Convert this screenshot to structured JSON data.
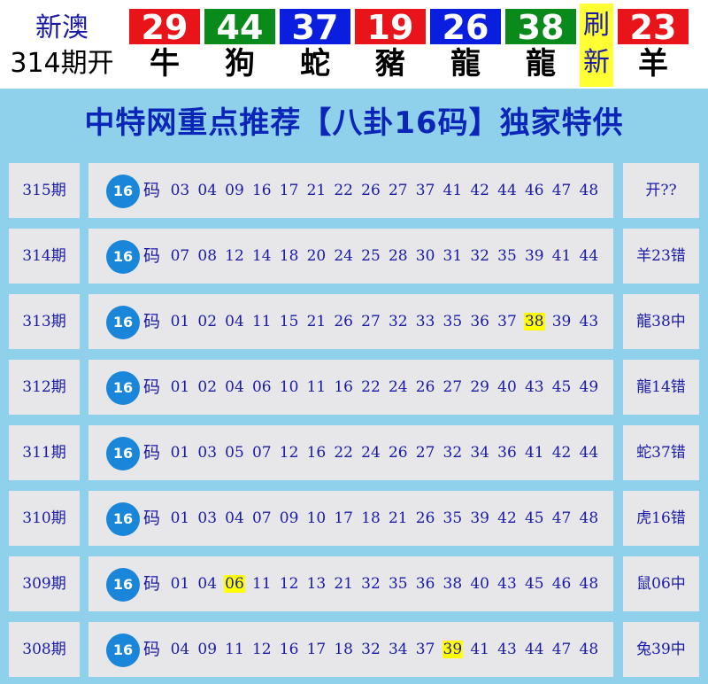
{
  "header": {
    "region": "新澳",
    "issue": "314期开",
    "balls": [
      {
        "number": "29",
        "zodiac": "牛",
        "color": "#e8141a"
      },
      {
        "number": "44",
        "zodiac": "狗",
        "color": "#0a8a1a"
      },
      {
        "number": "37",
        "zodiac": "蛇",
        "color": "#0a1ee0"
      },
      {
        "number": "19",
        "zodiac": "豬",
        "color": "#e8141a"
      },
      {
        "number": "26",
        "zodiac": "龍",
        "color": "#0a1ee0"
      },
      {
        "number": "38",
        "zodiac": "龍",
        "color": "#0a8a1a"
      }
    ],
    "refresh_label": "刷新",
    "special": {
      "number": "23",
      "zodiac": "羊",
      "color": "#e8141a"
    }
  },
  "banner": {
    "title": "中特网重点推荐【八卦16码】独家特供"
  },
  "rows": [
    {
      "issue": "315期",
      "badge": "16",
      "ma": "码",
      "numbers": [
        "03",
        "04",
        "09",
        "16",
        "17",
        "21",
        "22",
        "26",
        "27",
        "37",
        "41",
        "42",
        "44",
        "46",
        "47",
        "48"
      ],
      "highlight": null,
      "result": "开??"
    },
    {
      "issue": "314期",
      "badge": "16",
      "ma": "码",
      "numbers": [
        "07",
        "08",
        "12",
        "14",
        "18",
        "20",
        "24",
        "25",
        "28",
        "30",
        "31",
        "32",
        "35",
        "39",
        "41",
        "44"
      ],
      "highlight": null,
      "result": "羊23错"
    },
    {
      "issue": "313期",
      "badge": "16",
      "ma": "码",
      "numbers": [
        "01",
        "02",
        "04",
        "11",
        "15",
        "21",
        "26",
        "27",
        "32",
        "33",
        "35",
        "36",
        "37",
        "38",
        "39",
        "43"
      ],
      "highlight": "38",
      "result": "龍38中"
    },
    {
      "issue": "312期",
      "badge": "16",
      "ma": "码",
      "numbers": [
        "01",
        "02",
        "04",
        "06",
        "10",
        "11",
        "16",
        "22",
        "24",
        "26",
        "27",
        "29",
        "40",
        "43",
        "45",
        "49"
      ],
      "highlight": null,
      "result": "龍14错"
    },
    {
      "issue": "311期",
      "badge": "16",
      "ma": "码",
      "numbers": [
        "01",
        "03",
        "05",
        "07",
        "12",
        "16",
        "22",
        "24",
        "26",
        "27",
        "32",
        "34",
        "36",
        "41",
        "42",
        "44"
      ],
      "highlight": null,
      "result": "蛇37错"
    },
    {
      "issue": "310期",
      "badge": "16",
      "ma": "码",
      "numbers": [
        "01",
        "03",
        "04",
        "07",
        "09",
        "10",
        "17",
        "18",
        "21",
        "26",
        "35",
        "39",
        "42",
        "45",
        "47",
        "48"
      ],
      "highlight": null,
      "result": "虎16错"
    },
    {
      "issue": "309期",
      "badge": "16",
      "ma": "码",
      "numbers": [
        "01",
        "04",
        "06",
        "11",
        "12",
        "13",
        "21",
        "32",
        "35",
        "36",
        "38",
        "40",
        "43",
        "45",
        "46",
        "48"
      ],
      "highlight": "06",
      "result": "鼠06中"
    },
    {
      "issue": "308期",
      "badge": "16",
      "ma": "码",
      "numbers": [
        "04",
        "09",
        "11",
        "12",
        "16",
        "17",
        "18",
        "32",
        "34",
        "37",
        "39",
        "41",
        "43",
        "44",
        "47",
        "48"
      ],
      "highlight": "39",
      "result": "兔39中"
    }
  ]
}
